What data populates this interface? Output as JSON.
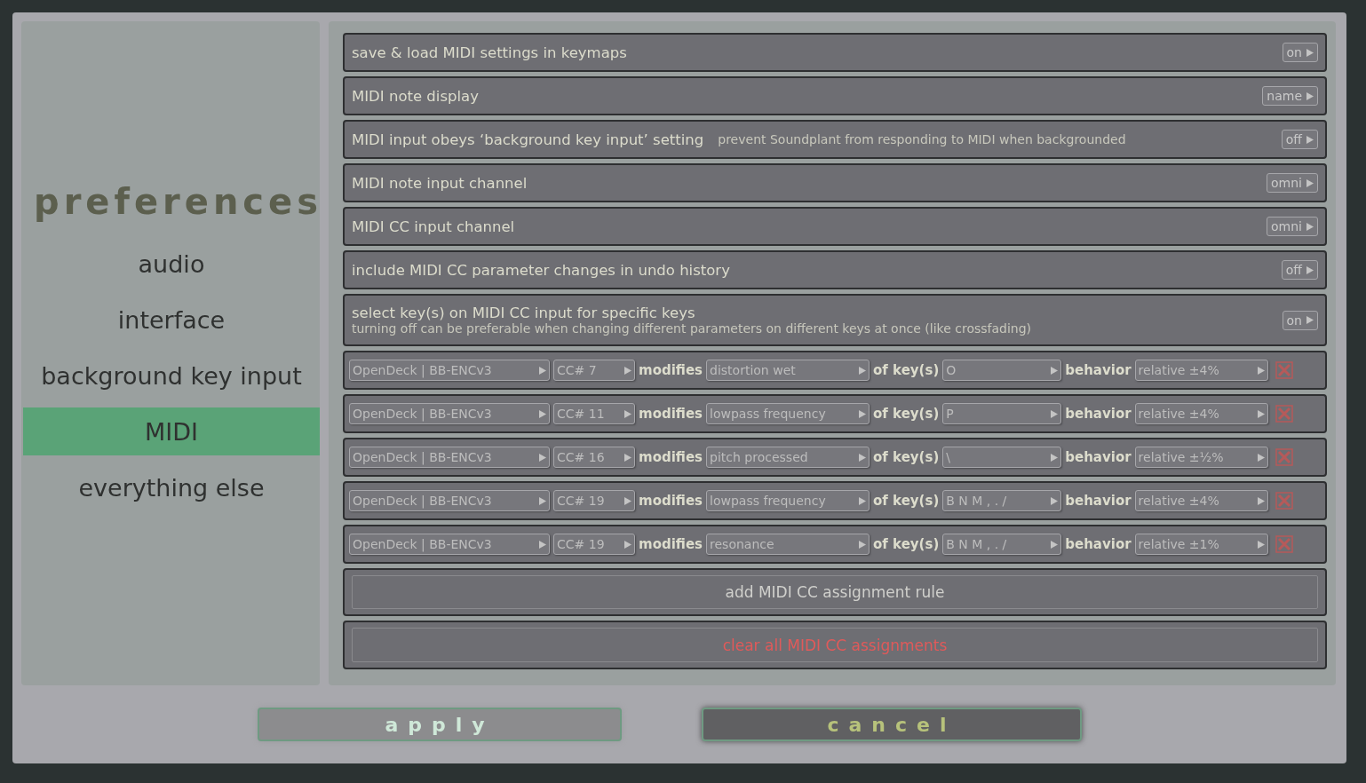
{
  "sidebar": {
    "title": "preferences",
    "items": [
      {
        "label": "audio",
        "selected": false
      },
      {
        "label": "interface",
        "selected": false
      },
      {
        "label": "background key input",
        "selected": false
      },
      {
        "label": "MIDI",
        "selected": true
      },
      {
        "label": "everything else",
        "selected": false
      }
    ]
  },
  "settings": [
    {
      "kind": "simple",
      "label": "save & load MIDI settings in keymaps",
      "value": "on"
    },
    {
      "kind": "simple",
      "label": "MIDI note display",
      "value": "name"
    },
    {
      "kind": "inline_note",
      "label": "MIDI input obeys ‘background key input’ setting",
      "note": "prevent Soundplant from responding to MIDI when backgrounded",
      "value": "off"
    },
    {
      "kind": "simple",
      "label": "MIDI note input channel",
      "value": "omni"
    },
    {
      "kind": "simple",
      "label": "MIDI CC input channel",
      "value": "omni"
    },
    {
      "kind": "simple",
      "label": "include MIDI CC parameter changes in undo history",
      "value": "off"
    },
    {
      "kind": "two_line",
      "label": "select key(s) on MIDI CC input for specific keys",
      "note": "turning off can be preferable when changing different parameters on different keys at once (like crossfading)",
      "value": "on"
    }
  ],
  "cc_rules": [
    {
      "device": "OpenDeck | BB-ENCv3",
      "cc": "CC# 7",
      "modifies_label": "modifies",
      "target": "distortion wet",
      "keys_label": "of key(s)",
      "keys": "O",
      "behavior_label": "behavior",
      "behavior": "relative ±4%"
    },
    {
      "device": "OpenDeck | BB-ENCv3",
      "cc": "CC# 11",
      "modifies_label": "modifies",
      "target": "lowpass frequency",
      "keys_label": "of key(s)",
      "keys": "P",
      "behavior_label": "behavior",
      "behavior": "relative ±4%"
    },
    {
      "device": "OpenDeck | BB-ENCv3",
      "cc": "CC# 16",
      "modifies_label": "modifies",
      "target": "pitch processed",
      "keys_label": "of key(s)",
      "keys": "\\",
      "behavior_label": "behavior",
      "behavior": "relative ±½%"
    },
    {
      "device": "OpenDeck | BB-ENCv3",
      "cc": "CC# 19",
      "modifies_label": "modifies",
      "target": "lowpass frequency",
      "keys_label": "of key(s)",
      "keys": "B N M , . /",
      "behavior_label": "behavior",
      "behavior": "relative ±4%"
    },
    {
      "device": "OpenDeck | BB-ENCv3",
      "cc": "CC# 19",
      "modifies_label": "modifies",
      "target": "resonance",
      "keys_label": "of key(s)",
      "keys": "B N M , . /",
      "behavior_label": "behavior",
      "behavior": "relative ±1%"
    }
  ],
  "actions": [
    {
      "kind": "normal",
      "label": "add MIDI CC assignment rule"
    },
    {
      "kind": "danger",
      "label": "clear all MIDI CC assignments"
    }
  ],
  "footer": [
    {
      "label": "apply",
      "disabled": true
    },
    {
      "label": "cancel",
      "disabled": false
    }
  ]
}
